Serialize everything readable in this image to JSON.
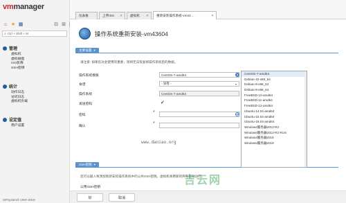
{
  "sidebar": {
    "logo_prefix": "vm",
    "logo_suffix": "manager",
    "search_placeholder": "Ctrl + Shift + M",
    "sections": [
      {
        "title": "管理",
        "items": [
          "虚拟机",
          "虚拟磁盘",
          "ISO影像",
          "SSH密钥"
        ]
      },
      {
        "title": "统计",
        "items": [
          "动作日志",
          "访问日志",
          "虚拟机负载"
        ]
      },
      {
        "title": "设定值",
        "items": [
          "用户设置"
        ]
      }
    ],
    "footer": "ISPsystem© 1997-2019"
  },
  "tabs": [
    {
      "label": "仪表板"
    },
    {
      "label": "上传ISO"
    },
    {
      "label": "虚拟机"
    },
    {
      "label": "重新安装操作系统-vm43 ..."
    }
  ],
  "page": {
    "title": "操作系统重新安装-vm43604",
    "main_section_label": "主要设置",
    "notice": "请注意: 如果您对此使用的重要，则将无法恢复将操作系统后的数据。",
    "ssh_section_label": "SSH密钥",
    "ssh_note": "您可以输入将添加到新安装操作系统中的公共SSH密钥。虚拟机将用新的所有密钥访问。",
    "ssh_label": "公用SSH密钥"
  },
  "form": {
    "os_template_label": "操作系统模板",
    "os_template_value": "CentOS-7-amd64",
    "recipe_label": "食谱",
    "recipe_value": "- 没有 -",
    "os_label": "操作系统",
    "os_value": "CentOS-7-amd64",
    "send_password_label": "发送密码",
    "password_label": "密码",
    "confirm_label": "确认"
  },
  "dropdown": {
    "options": [
      "CentOS-7-amd64",
      "Debian-10-x86_64",
      "Debian-8-x86_64",
      "Debian-9-x86_64",
      "FreeBSD-10-amd64",
      "FreeBSD-11-amd64",
      "FreeBSD-12-amd64",
      "Ubuntu-14.04-amd64",
      "Ubuntu-16.04-amd64",
      "Ubuntu-18.04-amd64",
      "Windows服务器2012-R2",
      "Windows服务器2012-R2 RUS",
      "Windows服务器2016",
      "Windows服务器2019"
    ],
    "selected": "CentOS-7-amd64"
  },
  "watermarks": {
    "url": "www.daniao.org",
    "logo": "吉云网"
  },
  "buttons": {
    "ok": "好",
    "cancel": "取消"
  },
  "colors": {
    "accent": "#5b93cc",
    "brand_red": "#c8232c",
    "help_blue": "#3d7cc9"
  }
}
